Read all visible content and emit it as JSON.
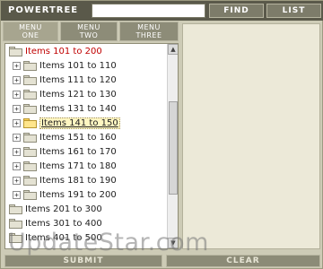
{
  "header": {
    "title": "POWERTREE",
    "search_value": "",
    "find_label": "FIND",
    "list_label": "LIST"
  },
  "tabs": [
    {
      "line1": "MENU",
      "line2": "ONE"
    },
    {
      "line1": "MENU",
      "line2": "TWO"
    },
    {
      "line1": "MENU",
      "line2": "THREE"
    }
  ],
  "tree": {
    "items": [
      {
        "label": "Items 101 to 200",
        "level": 0,
        "expander": "",
        "style": "red",
        "open": false
      },
      {
        "label": "Items 101 to 110",
        "level": 1,
        "expander": "+",
        "style": "",
        "open": false
      },
      {
        "label": "Items 111 to 120",
        "level": 1,
        "expander": "+",
        "style": "",
        "open": false
      },
      {
        "label": "Items 121 to 130",
        "level": 1,
        "expander": "+",
        "style": "",
        "open": false
      },
      {
        "label": "Items 131 to 140",
        "level": 1,
        "expander": "+",
        "style": "",
        "open": false
      },
      {
        "label": "Items 141 to 150",
        "level": 1,
        "expander": "+",
        "style": "selected",
        "open": true
      },
      {
        "label": "Items 151 to 160",
        "level": 1,
        "expander": "+",
        "style": "",
        "open": false
      },
      {
        "label": "Items 161 to 170",
        "level": 1,
        "expander": "+",
        "style": "",
        "open": false
      },
      {
        "label": "Items 171 to 180",
        "level": 1,
        "expander": "+",
        "style": "",
        "open": false
      },
      {
        "label": "Items 181 to 190",
        "level": 1,
        "expander": "+",
        "style": "",
        "open": false
      },
      {
        "label": "Items 191 to 200",
        "level": 1,
        "expander": "+",
        "style": "",
        "open": false
      },
      {
        "label": "Items 201 to 300",
        "level": 0,
        "expander": "",
        "style": "",
        "open": false
      },
      {
        "label": "Items 301 to 400",
        "level": 0,
        "expander": "",
        "style": "",
        "open": false
      },
      {
        "label": "Items 401 to 500",
        "level": 0,
        "expander": "",
        "style": "",
        "open": false
      }
    ]
  },
  "footer": {
    "submit_label": "SUBMIT",
    "clear_label": "CLEAR"
  },
  "watermark": "UpdateStar.com",
  "colors": {
    "red_item": "#c00000",
    "toolbar_bg": "#5a594a",
    "panel_bg": "#ece9d8"
  }
}
